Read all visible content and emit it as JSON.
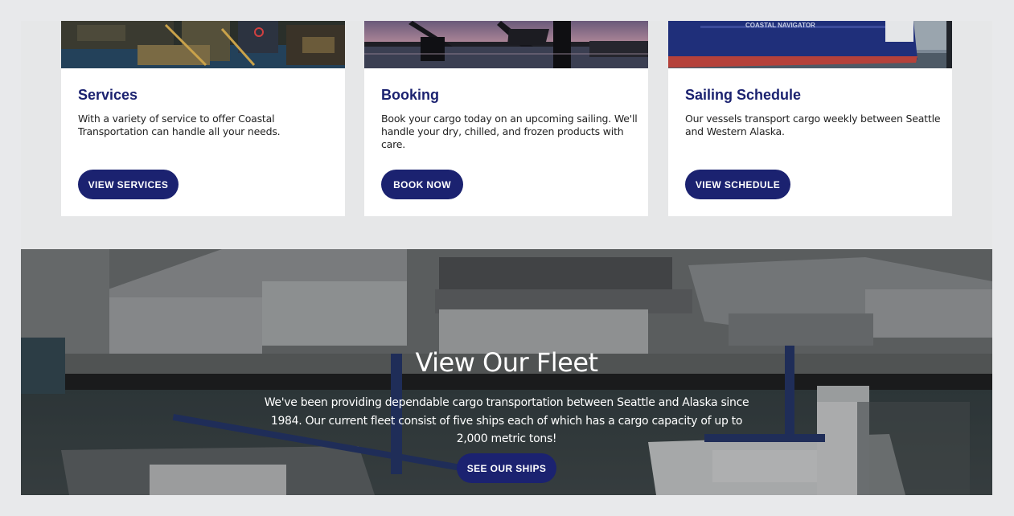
{
  "cards": [
    {
      "title": "Services",
      "text": "With a variety of service to offer Coastal Transportation can handle all your needs.",
      "button": "VIEW SERVICES",
      "image": "harbor-docks-photo"
    },
    {
      "title": "Booking",
      "text": "Book your cargo today on an upcoming sailing. We'll handle your dry, chilled, and frozen products with care.",
      "button": "BOOK NOW",
      "image": "bridge-sunset-photo"
    },
    {
      "title": "Sailing Schedule",
      "text": "Our vessels transport cargo weekly between Seattle and Western Alaska.",
      "button": "VIEW SCHEDULE",
      "image": "cargo-ship-photo",
      "ship_name": "COASTAL NAVIGATOR"
    }
  ],
  "fleet": {
    "title": "View Our Fleet",
    "text": "We've been providing dependable cargo transportation between Seattle and Alaska since 1984. Our current fleet consist of five ships each of which has a cargo capacity of up to 2,000 metric tons!",
    "button": "SEE OUR SHIPS",
    "image": "aerial-port-photo"
  },
  "colors": {
    "brand_navy": "#1b2270",
    "page_bg": "#e6e7e8",
    "card_bg": "#ffffff"
  }
}
